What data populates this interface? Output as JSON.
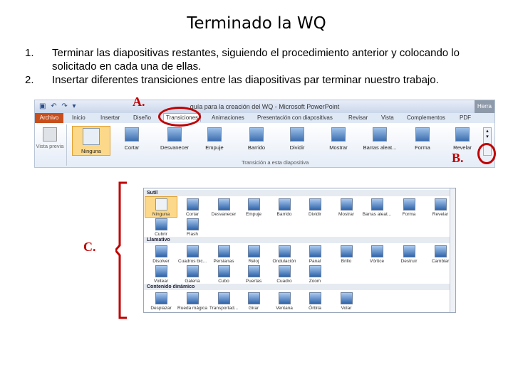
{
  "title": "Terminado la WQ",
  "steps": [
    {
      "num": "1.",
      "text": "Terminar las diapositivas restantes, siguiendo el procedimiento anterior y colocando lo solicitado en cada una de ellas."
    },
    {
      "num": "2.",
      "text": "Insertar diferentes transiciones entre las diapositivas par terminar nuestro trabajo."
    }
  ],
  "markers": {
    "a": "A.",
    "b": "B.",
    "c": "C."
  },
  "ribbon": {
    "window_title": "guía para la creación del WQ - Microsoft PowerPoint",
    "user_tab": "Herra",
    "tabs": [
      "Archivo",
      "Inicio",
      "Insertar",
      "Diseño",
      "Transiciones",
      "Animaciones",
      "Presentación con diapositivas",
      "Revisar",
      "Vista",
      "Complementos",
      "PDF"
    ],
    "preview_label": "Vista previa",
    "group_label": "Transición a esta diapositiva",
    "buttons": [
      "Ninguna",
      "Cortar",
      "Desvanecer",
      "Empuje",
      "Barrido",
      "Dividir",
      "Mostrar",
      "Barras aleat...",
      "Forma",
      "Revelar"
    ]
  },
  "gallery": {
    "sections": [
      {
        "label": "Sutil",
        "rows": [
          [
            "Ninguna",
            "Cortar",
            "Desvanecer",
            "Empuje",
            "Barrido",
            "Dividir",
            "Mostrar",
            "Barras aleat...",
            "Forma",
            "Revelar"
          ],
          [
            "Cubrir",
            "Flash"
          ]
        ]
      },
      {
        "label": "Llamativo",
        "rows": [
          [
            "Disolver",
            "Cuadros bic...",
            "Persianas",
            "Reloj",
            "Ondulación",
            "Panal",
            "Brillo",
            "Vórtice",
            "Destruir",
            "Cambiar"
          ],
          [
            "Voltear",
            "Galería",
            "Cubo",
            "Puertas",
            "Cuadro",
            "Zoom"
          ]
        ]
      },
      {
        "label": "Contenido dinámico",
        "rows": [
          [
            "Desplazar",
            "Rueda mágica",
            "Transportad...",
            "Girar",
            "Ventana",
            "Órbita",
            "Volar"
          ]
        ]
      }
    ]
  }
}
